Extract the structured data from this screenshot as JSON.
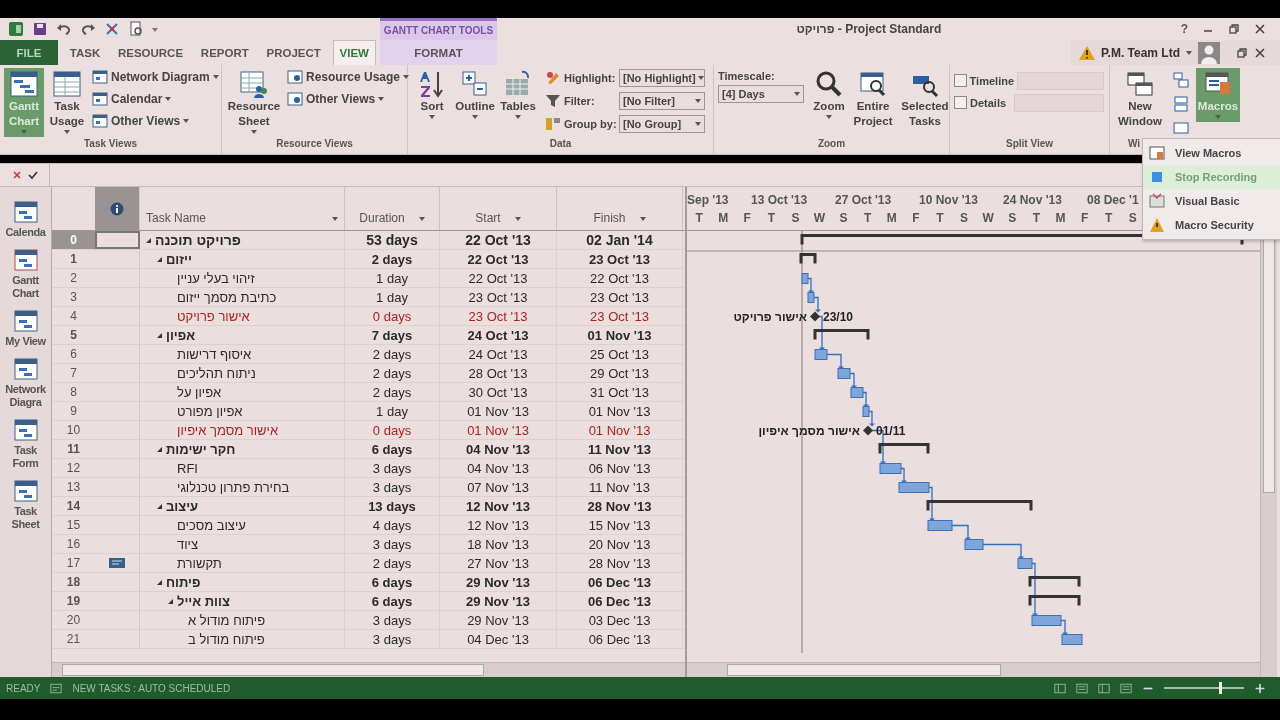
{
  "window": {
    "title": "פרויקט - Project Standard",
    "context_group": "GANTT CHART TOOLS",
    "help": "?"
  },
  "tabs": [
    {
      "label": "FILE",
      "kind": "file",
      "selected": false
    },
    {
      "label": "TASK",
      "kind": "tab",
      "selected": false
    },
    {
      "label": "RESOURCE",
      "kind": "tab",
      "selected": false
    },
    {
      "label": "REPORT",
      "kind": "tab",
      "selected": false
    },
    {
      "label": "PROJECT",
      "kind": "tab",
      "selected": false
    },
    {
      "label": "VIEW",
      "kind": "tab",
      "selected": true
    },
    {
      "label": "FORMAT",
      "kind": "context",
      "selected": false
    }
  ],
  "account": {
    "name": "P.M. Team Ltd"
  },
  "ribbon": {
    "task_views": {
      "label": "Task Views",
      "large": [
        {
          "label": "Gantt Chart",
          "selected": true
        },
        {
          "label": "Task Usage",
          "selected": false
        }
      ],
      "small": [
        "Network Diagram",
        "Calendar",
        "Other Views"
      ]
    },
    "resource_views": {
      "label": "Resource Views",
      "large": "Resource Sheet",
      "small": [
        "Resource Usage",
        "Other Views"
      ]
    },
    "data": {
      "label": "Data",
      "buttons": [
        "Sort",
        "Outline",
        "Tables"
      ],
      "fields": [
        {
          "label": "Highlight:",
          "value": "[No Highlight]"
        },
        {
          "label": "Filter:",
          "value": "[No Filter]"
        },
        {
          "label": "Group by:",
          "value": "[No Group]"
        }
      ]
    },
    "zoom": {
      "label": "Zoom",
      "timescale_label": "Timescale:",
      "timescale_value": "[4] Days",
      "buttons": [
        "Zoom",
        "Entire Project",
        "Selected Tasks"
      ]
    },
    "split_view": {
      "label": "Split View",
      "options": [
        {
          "label": "Timeline",
          "checked": false
        },
        {
          "label": "Details",
          "checked": false
        }
      ]
    },
    "window": {
      "label": "Wi",
      "new_window": "New Window",
      "macros": {
        "label": "Macros",
        "expanded": true,
        "menu": [
          {
            "label": "View Macros",
            "selected": false
          },
          {
            "label": "Stop Recording",
            "selected": true
          },
          {
            "label": "Visual Basic",
            "selected": false
          },
          {
            "label": "Macro Security",
            "selected": false
          }
        ]
      }
    }
  },
  "view_bar": [
    "Calenda",
    "Gantt Chart",
    "My View",
    "Network Diagra",
    "Task Form",
    "Task Sheet"
  ],
  "table": {
    "columns": [
      "Task Name",
      "Duration",
      "Start",
      "Finish"
    ],
    "rows": [
      {
        "id": "0",
        "name": "פרויקט תוכנה",
        "kind": "project",
        "duration": "53 days",
        "start": "22 Oct '13",
        "finish": "02 Jan '14",
        "selected": true,
        "note": false,
        "children": [
          {
            "id": "1",
            "name": "ייזום",
            "kind": "summary",
            "duration": "2 days",
            "start": "22 Oct '13",
            "finish": "23 Oct '13",
            "selected": false,
            "note": false,
            "children": [
              {
                "id": "2",
                "name": "זיהוי בעלי עניין",
                "kind": "task",
                "duration": "1 day",
                "start": "22 Oct '13",
                "finish": "22 Oct '13",
                "selected": false,
                "note": false
              },
              {
                "id": "3",
                "name": "כתיבת מסמך ייזום",
                "kind": "task",
                "duration": "1 day",
                "start": "23 Oct '13",
                "finish": "23 Oct '13",
                "selected": false,
                "note": false
              },
              {
                "id": "4",
                "name": "אישור פרויקט",
                "kind": "milestone",
                "duration": "0 days",
                "start": "23 Oct '13",
                "finish": "23 Oct '13",
                "selected": false,
                "note": false
              }
            ]
          },
          {
            "id": "5",
            "name": "אפיון",
            "kind": "summary",
            "duration": "7 days",
            "start": "24 Oct '13",
            "finish": "01 Nov '13",
            "selected": false,
            "note": false,
            "children": [
              {
                "id": "6",
                "name": "איסוף דרישות",
                "kind": "task",
                "duration": "2 days",
                "start": "24 Oct '13",
                "finish": "25 Oct '13",
                "selected": false,
                "note": false
              },
              {
                "id": "7",
                "name": "ניתוח תהליכים",
                "kind": "task",
                "duration": "2 days",
                "start": "28 Oct '13",
                "finish": "29 Oct '13",
                "selected": false,
                "note": false
              },
              {
                "id": "8",
                "name": "אפיון על",
                "kind": "task",
                "duration": "2 days",
                "start": "30 Oct '13",
                "finish": "31 Oct '13",
                "selected": false,
                "note": false
              },
              {
                "id": "9",
                "name": "אפיון מפורט",
                "kind": "task",
                "duration": "1 day",
                "start": "01 Nov '13",
                "finish": "01 Nov '13",
                "selected": false,
                "note": false
              },
              {
                "id": "10",
                "name": "אישור מסמך איפיון",
                "kind": "milestone",
                "duration": "0 days",
                "start": "01 Nov '13",
                "finish": "01 Nov '13",
                "selected": false,
                "note": false
              }
            ]
          },
          {
            "id": "11",
            "name": "חקר ישימות",
            "kind": "summary",
            "duration": "6 days",
            "start": "04 Nov '13",
            "finish": "11 Nov '13",
            "selected": false,
            "note": false,
            "children": [
              {
                "id": "12",
                "name": "RFI",
                "kind": "task",
                "duration": "3 days",
                "start": "04 Nov '13",
                "finish": "06 Nov '13",
                "selected": false,
                "note": false
              },
              {
                "id": "13",
                "name": "בחירת פתרון טכנלוגי",
                "kind": "task",
                "duration": "3 days",
                "start": "07 Nov '13",
                "finish": "11 Nov '13",
                "selected": false,
                "note": false
              }
            ]
          },
          {
            "id": "14",
            "name": "עיצוב",
            "kind": "summary",
            "duration": "13 days",
            "start": "12 Nov '13",
            "finish": "28 Nov '13",
            "selected": false,
            "note": false,
            "children": [
              {
                "id": "15",
                "name": "עיצוב מסכים",
                "kind": "task",
                "duration": "4 days",
                "start": "12 Nov '13",
                "finish": "15 Nov '13",
                "selected": false,
                "note": false
              },
              {
                "id": "16",
                "name": "ציוד",
                "kind": "task",
                "duration": "3 days",
                "start": "18 Nov '13",
                "finish": "20 Nov '13",
                "selected": false,
                "note": false
              },
              {
                "id": "17",
                "name": "תקשורת",
                "kind": "task",
                "duration": "2 days",
                "start": "27 Nov '13",
                "finish": "28 Nov '13",
                "selected": false,
                "note": true
              }
            ]
          },
          {
            "id": "18",
            "name": "פיתוח",
            "kind": "summary",
            "duration": "6 days",
            "start": "29 Nov '13",
            "finish": "06 Dec '13",
            "selected": false,
            "note": false,
            "children": [
              {
                "id": "19",
                "name": "צוות אייל",
                "kind": "summary",
                "duration": "6 days",
                "start": "29 Nov '13",
                "finish": "06 Dec '13",
                "selected": false,
                "note": false,
                "children": [
                  {
                    "id": "20",
                    "name": "פיתוח מודול א",
                    "kind": "task",
                    "duration": "3 days",
                    "start": "29 Nov '13",
                    "finish": "03 Dec '13",
                    "selected": false,
                    "note": false
                  },
                  {
                    "id": "21",
                    "name": "פיתוח מודול ב",
                    "kind": "task",
                    "duration": "3 days",
                    "start": "04 Dec '13",
                    "finish": "06 Dec '13",
                    "selected": false,
                    "note": false
                  }
                ]
              }
            ]
          }
        ]
      }
    ]
  },
  "gantt": {
    "timescale_top": [
      "Sep '13",
      "13 Oct '13",
      "27 Oct '13",
      "10 Nov '13",
      "24 Nov '13",
      "08 Dec '1"
    ],
    "timescale_days": [
      "T",
      "M",
      "F",
      "T",
      "S",
      "W",
      "S",
      "T",
      "M",
      "F",
      "T",
      "S",
      "W",
      "S",
      "T",
      "M",
      "F",
      "T",
      "S"
    ],
    "milestones": [
      {
        "name": "אישור פרויקט",
        "date": "23/10"
      },
      {
        "name": "אישור מסמך איפיון",
        "date": "01/11"
      }
    ]
  },
  "status_bar": {
    "mode": "READY",
    "scheduling": "NEW TASKS : AUTO SCHEDULED",
    "zoom": {
      "level": 0.7
    }
  }
}
